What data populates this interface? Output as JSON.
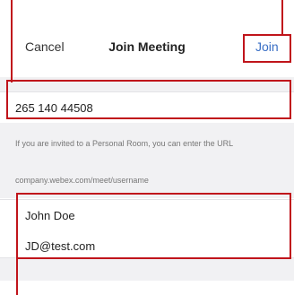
{
  "header": {
    "cancel_label": "Cancel",
    "title": "Join Meeting",
    "join_label": "Join"
  },
  "meeting": {
    "number_value": "265 140 44508"
  },
  "hint": {
    "line1": "If you are invited to a Personal Room, you can enter the URL",
    "line2": "company.webex.com/meet/username"
  },
  "user": {
    "name_value": "John Doe",
    "email_value": "JD@test.com"
  },
  "colors": {
    "accent": "#3a6fc5",
    "annotation": "#c0141b",
    "band": "#f1f1f3"
  }
}
